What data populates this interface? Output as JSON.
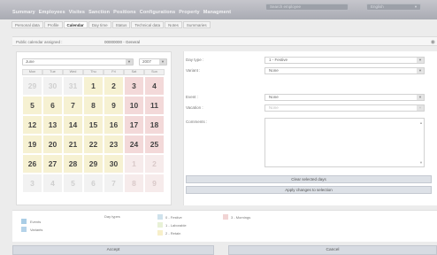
{
  "topbar": {
    "menu": [
      "Summary",
      "Employees",
      "Visites",
      "Sanction",
      "Positions",
      "Configurations",
      "Property",
      "Managment"
    ],
    "search_placeholder": "Search employee",
    "language": "English"
  },
  "tabs": [
    "Personal data",
    "Profile",
    "Calendar",
    "Day time",
    "Status",
    "Technical data",
    "Notes",
    "Summaries"
  ],
  "active_tab": "Calendar",
  "calendar_info": {
    "label": "Public calendar assigned :",
    "value": "00000000 - General"
  },
  "calendar": {
    "month": "June",
    "year": "2007",
    "weekdays": [
      "Mon",
      "Tue",
      "Wed",
      "Thu",
      "Fri",
      "Sat",
      "Sun"
    ],
    "weeks": [
      [
        "29",
        "30",
        "31",
        "1",
        "2",
        "3",
        "4"
      ],
      [
        "5",
        "6",
        "7",
        "8",
        "9",
        "10",
        "11"
      ],
      [
        "12",
        "13",
        "14",
        "15",
        "16",
        "17",
        "18"
      ],
      [
        "19",
        "20",
        "21",
        "22",
        "23",
        "24",
        "25"
      ],
      [
        "26",
        "27",
        "28",
        "29",
        "30",
        "1",
        "2"
      ],
      [
        "3",
        "4",
        "5",
        "6",
        "7",
        "8",
        "9"
      ]
    ]
  },
  "form": {
    "day_type_label": "Day type :",
    "day_type_value": "1 - Festive",
    "variant_label": "Variant :",
    "variant_value": "None",
    "event_label": "Event :",
    "event_value": "None",
    "vacation_label": "Vacation :",
    "vacation_value": "None",
    "comments_label": "Comments :",
    "clear_button": "Clear selected days",
    "apply_button": "Apply changes to selection"
  },
  "legend": {
    "items_left": [
      "Events",
      "Variants"
    ],
    "day_types_label": "Day types",
    "day_types": [
      "0 - Festive",
      "1 - Laborable",
      "2 - Retain",
      "3 - Mornings"
    ],
    "colors": {
      "events": "#a9cde6",
      "variants": "#b5d3e9",
      "festive": "#cfe2ec",
      "laborable": "#e8f1d6",
      "retain": "#f7efc9",
      "mornings": "#f1d4d4"
    }
  },
  "buttons": {
    "accept": "Accept",
    "cancel": "Cancel"
  }
}
